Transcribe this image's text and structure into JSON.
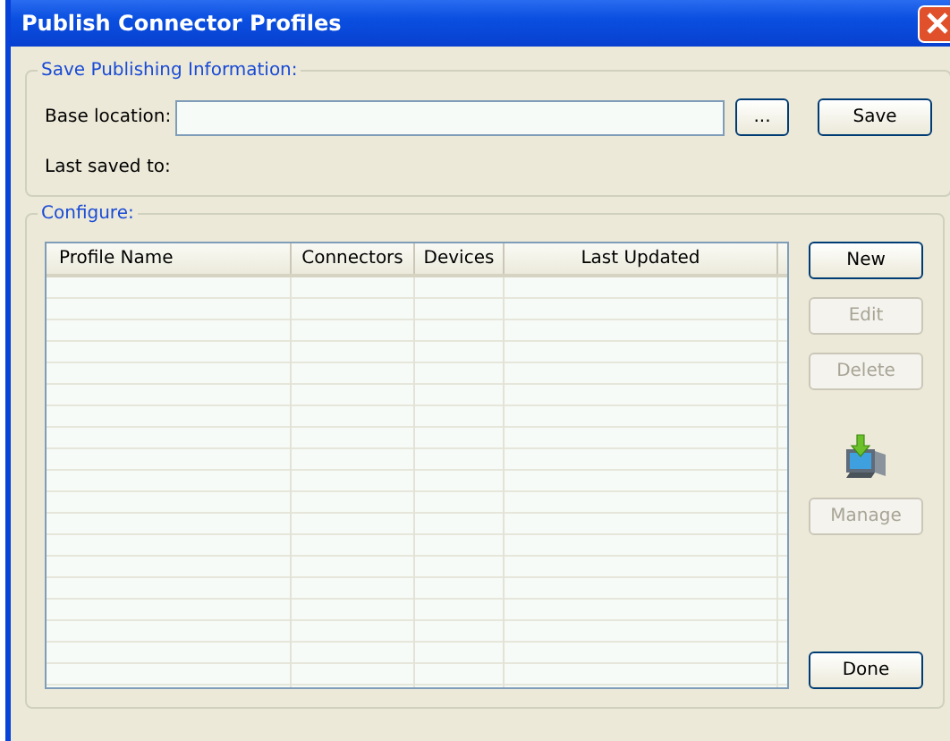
{
  "window": {
    "title": "Publish Connector Profiles"
  },
  "save_group": {
    "title": "Save Publishing Information:",
    "base_location_label": "Base location:",
    "browse_button": "...",
    "save_button": "Save",
    "last_saved_label": "Last saved to:"
  },
  "configure_group": {
    "title": "Configure:",
    "table": {
      "columns": [
        "Profile Name",
        "Connectors",
        "Devices",
        "Last Updated"
      ]
    },
    "buttons": [
      {
        "label": "New",
        "disabled": false,
        "kind": "button"
      },
      {
        "label": "Edit",
        "disabled": true,
        "kind": "button"
      },
      {
        "label": "Delete",
        "disabled": true,
        "kind": "button"
      },
      {
        "kind": "icon"
      },
      {
        "label": "Manage",
        "disabled": true,
        "kind": "button"
      },
      {
        "label": "Done",
        "disabled": false,
        "kind": "bottom"
      }
    ]
  }
}
